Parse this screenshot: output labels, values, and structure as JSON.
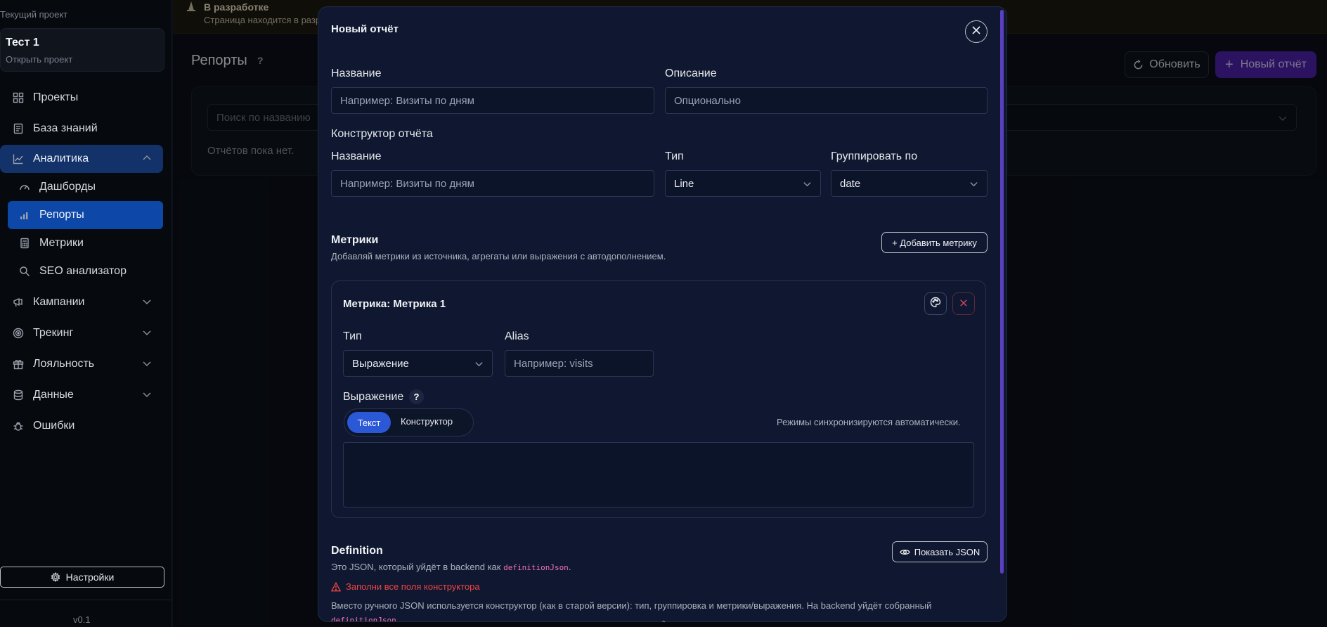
{
  "sidebar": {
    "caption": "Текущий проект",
    "project": {
      "name": "Тест 1",
      "open_label": "Открыть проект"
    },
    "nav": {
      "projects": "Проекты",
      "knowledge": "База знаний",
      "analytics": "Аналитика",
      "dashboards": "Дашборды",
      "reports": "Репорты",
      "metrics": "Метрики",
      "seo": "SEO анализатор",
      "campaigns": "Кампании",
      "tracking": "Трекинг",
      "loyalty": "Лояльность",
      "data": "Данные",
      "errors": "Ошибки"
    },
    "settings_label": "Настройки",
    "version": "v0.1"
  },
  "banner": {
    "title": "В разработке",
    "text": "Страница находится в разработке"
  },
  "page": {
    "title": "Репорты",
    "help": "?",
    "refresh_label": "Обновить",
    "new_report_label": "Новый отчёт",
    "search_placeholder": "Поиск по названию",
    "empty_text": "Отчётов пока нет."
  },
  "modal": {
    "title": "Новый отчёт",
    "name_label": "Название",
    "name_placeholder": "Например: Визиты по дням",
    "description_label": "Описание",
    "description_placeholder": "Опционально",
    "constructor_title": "Конструктор отчёта",
    "c_name_label": "Название",
    "c_name_placeholder": "Например: Визиты по дням",
    "type_label": "Тип",
    "type_value": "Line",
    "group_label": "Группировать по",
    "group_value": "date",
    "metrics_title": "Метрики",
    "metrics_hint": "Добавляй метрики из источника, агрегаты или выражения с автодополнением.",
    "add_metric_label": "+ Добавить метрику",
    "metric": {
      "title": "Метрика: Метрика 1",
      "type_label": "Тип",
      "type_value": "Выражение",
      "alias_label": "Alias",
      "alias_placeholder": "Например: visits",
      "expression_label": "Выражение",
      "help": "?",
      "mode_text": "Текст",
      "mode_constructor": "Конструктор",
      "sync_hint": "Режимы синхронизируются автоматически."
    },
    "definition": {
      "title": "Definition",
      "desc_prefix": "Это JSON, который уйдёт в backend как",
      "desc_code": "definitionJson",
      "desc_suffix": ".",
      "show_json_label": "Показать JSON",
      "error": "Заполни все поля конструктора",
      "note": "Вместо ручного JSON используется конструктор (как в старой версии): тип, группировка и метрики/выражения. На backend уйдёт собранный",
      "note_code": "definitionJson",
      "note_suffix": "."
    }
  },
  "colors": {
    "accent_blue": "#2b58d6",
    "accent_purple": "#4b21a8",
    "error_red": "#ef4444",
    "code_pink": "#f472b6"
  }
}
